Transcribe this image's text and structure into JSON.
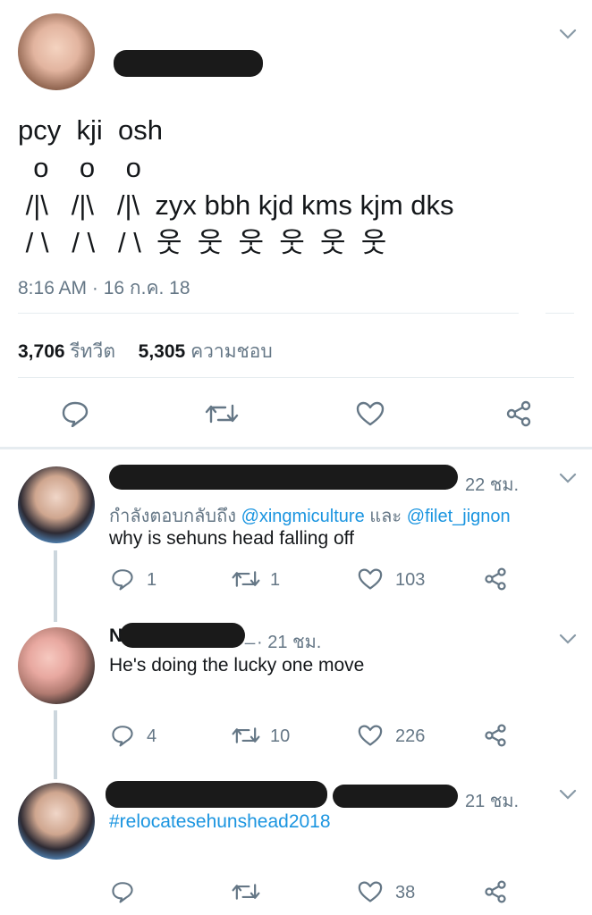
{
  "main_tweet": {
    "text_lines": [
      "pcy  kji  osh",
      "  o    o    o",
      " /|\\   /|\\   /|\\  zyx bbh kjd kms kjm dks",
      " / \\   / \\   / \\  웃  웃  웃  웃  웃  웃"
    ],
    "timestamp": "8:16 AM · 16 ก.ค. 18",
    "retweet_count": "3,706",
    "retweet_label": "รีทวีต",
    "like_count": "5,305",
    "like_label": "ความชอบ"
  },
  "replies": [
    {
      "time": "22 ชม.",
      "replying_prefix": "กำลังตอบกลับถึง",
      "mention1": "@xingmiculture",
      "conj": "และ",
      "mention2": "@filet_jignon",
      "text": "why is sehuns head falling off",
      "reply_count": "1",
      "retweet_count": "1",
      "like_count": "103"
    },
    {
      "name_initial": "N",
      "name_suffix": "_",
      "time": "· 21 ชม.",
      "text": "He's doing the lucky one move",
      "reply_count": "4",
      "retweet_count": "10",
      "like_count": "226"
    },
    {
      "time": "21 ชม.",
      "text": "#relocatesehunshead2018",
      "like_count": "38"
    }
  ],
  "icons": [
    "chevron-down-icon",
    "reply-icon",
    "retweet-icon",
    "heart-icon",
    "share-icon"
  ],
  "colors": {
    "link": "#1b95e0",
    "muted": "#657786",
    "icon": "#657786",
    "divider": "#e6ecf0"
  }
}
